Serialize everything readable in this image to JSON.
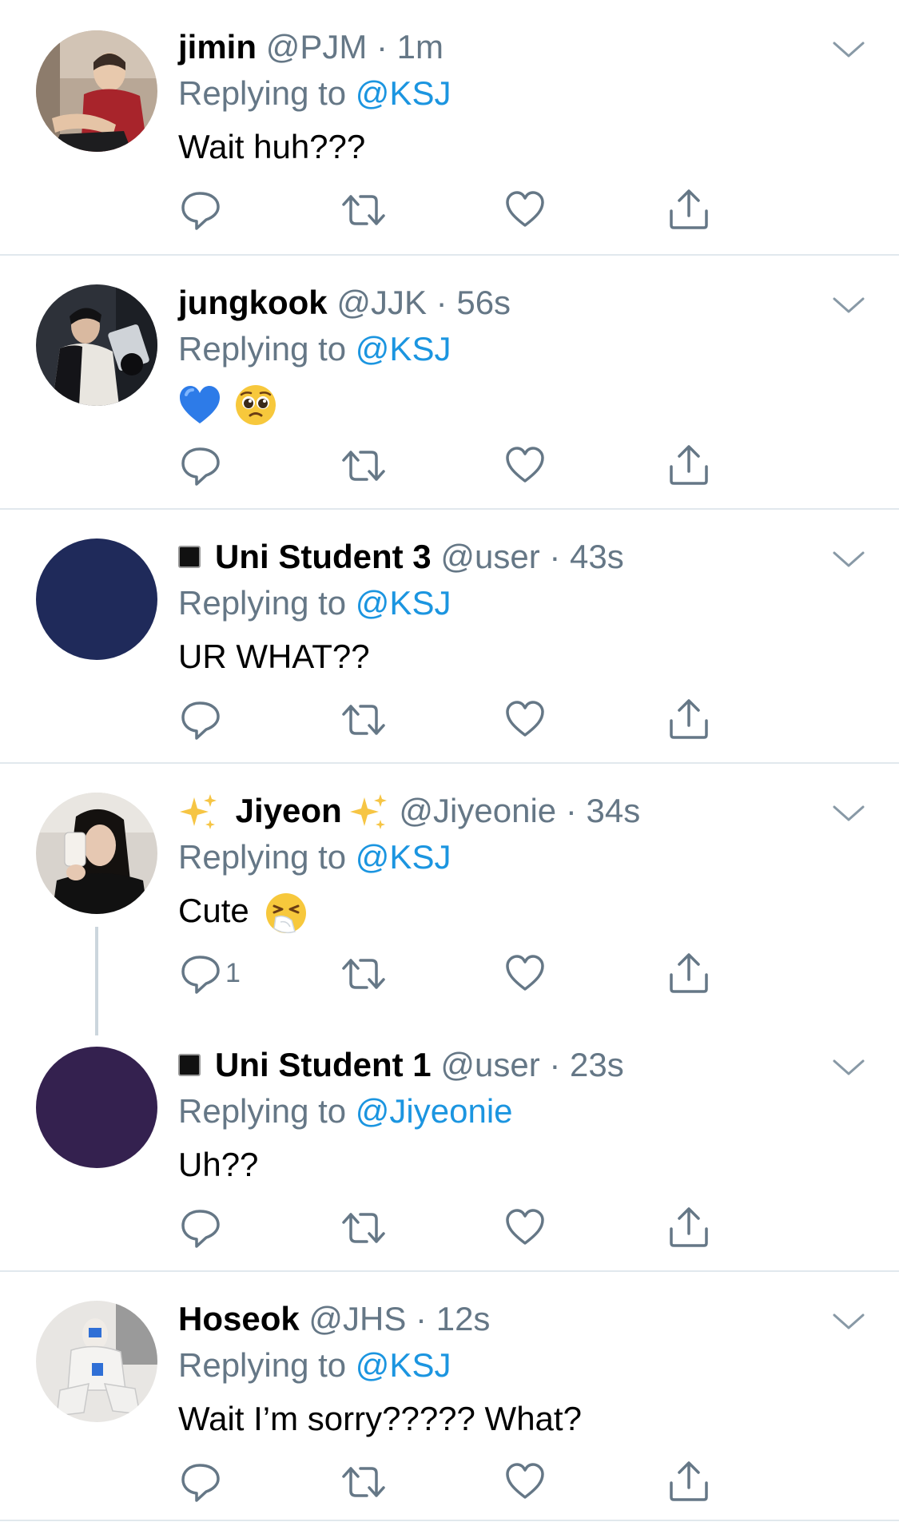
{
  "colors": {
    "accent": "#1b95e0",
    "meta_gray": "#657786",
    "separator": "#e1e8ed",
    "thread_line": "#ccd6dd"
  },
  "tweets": [
    {
      "name": "jimin",
      "handle": "@PJM",
      "dot": "·",
      "time": "1m",
      "replying_label": "Replying to",
      "replying_to": "@KSJ",
      "text": "Wait huh???",
      "avatar_icon": "photo-avatar-red-shirt",
      "reply_count": ""
    },
    {
      "name": "jungkook",
      "handle": "@JJK",
      "dot": "·",
      "time": "56s",
      "replying_label": "Replying to",
      "replying_to": "@KSJ",
      "text": "",
      "emojis": [
        "blue-heart-emoji",
        "pleading-face-emoji"
      ],
      "avatar_icon": "photo-avatar-studio",
      "reply_count": ""
    },
    {
      "name": "Uni Student 3",
      "handle": "@user",
      "dot": "·",
      "time": "43s",
      "replying_label": "Replying to",
      "replying_to": "@KSJ",
      "text": "UR WHAT??",
      "avatar_color": "#1f2a5a",
      "name_prefix_icon": "black-square-icon",
      "reply_count": ""
    },
    {
      "name": "Jiyeon",
      "handle": "@Jiyeonie",
      "dot": "·",
      "time": "34s",
      "replying_label": "Replying to",
      "replying_to": "@KSJ",
      "text": "Cute",
      "emojis": [
        "sneezing-face-emoji"
      ],
      "name_decorations": "sparkles-emoji",
      "avatar_icon": "photo-avatar-mirror-selfie",
      "reply_count": "1"
    },
    {
      "name": "Uni Student 1",
      "handle": "@user",
      "dot": "·",
      "time": "23s",
      "replying_label": "Replying to",
      "replying_to": "@Jiyeonie",
      "text": "Uh??",
      "avatar_color": "#34214f",
      "name_prefix_icon": "black-square-icon",
      "reply_count": ""
    },
    {
      "name": "Hoseok",
      "handle": "@JHS",
      "dot": "·",
      "time": "12s",
      "replying_label": "Replying to",
      "replying_to": "@KSJ",
      "text": "Wait I’m sorry????? What?",
      "avatar_icon": "photo-avatar-white-outfit",
      "reply_count": ""
    }
  ]
}
